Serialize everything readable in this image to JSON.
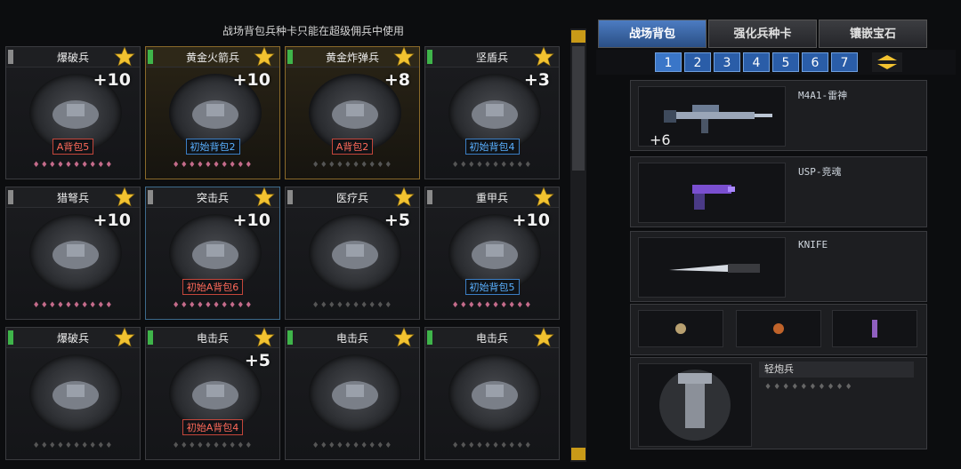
{
  "notice": "战场背包兵种卡只能在超级佣兵中使用",
  "cards": [
    {
      "name": "爆破兵",
      "level": "+10",
      "pack": "A背包5",
      "tag": "red",
      "flag": "gray",
      "style": "",
      "gems": "♦♦♦♦♦♦♦♦♦♦"
    },
    {
      "name": "黄金火箭兵",
      "level": "+10",
      "pack": "初始背包2",
      "tag": "blue",
      "flag": "green",
      "style": "gold",
      "gems": "♦♦♦♦♦♦♦♦♦♦"
    },
    {
      "name": "黄金炸弹兵",
      "level": "+8",
      "pack": "A背包2",
      "tag": "red",
      "flag": "green",
      "style": "gold",
      "gems": "♦♦♦♦♦♦♦♦♦♦"
    },
    {
      "name": "坚盾兵",
      "level": "+3",
      "pack": "初始背包4",
      "tag": "blue",
      "flag": "green",
      "style": "",
      "gems": "♦♦♦♦♦♦♦♦♦♦"
    },
    {
      "name": "猎弩兵",
      "level": "+10",
      "pack": "",
      "tag": "",
      "flag": "gray",
      "style": "",
      "gems": "♦♦♦♦♦♦♦♦♦♦"
    },
    {
      "name": "突击兵",
      "level": "+10",
      "pack": "初始A背包6",
      "tag": "red",
      "flag": "gray",
      "style": "blue",
      "gems": "♦♦♦♦♦♦♦♦♦♦"
    },
    {
      "name": "医疗兵",
      "level": "+5",
      "pack": "",
      "tag": "",
      "flag": "gray",
      "style": "",
      "gems": "♦♦♦♦♦♦♦♦♦♦"
    },
    {
      "name": "重甲兵",
      "level": "+10",
      "pack": "初始背包5",
      "tag": "blue",
      "flag": "gray",
      "style": "",
      "gems": "♦♦♦♦♦♦♦♦♦♦"
    },
    {
      "name": "爆破兵",
      "level": "",
      "pack": "",
      "tag": "",
      "flag": "green",
      "style": "",
      "gems": "♦♦♦♦♦♦♦♦♦♦"
    },
    {
      "name": "电击兵",
      "level": "+5",
      "pack": "初始A背包4",
      "tag": "red",
      "flag": "green",
      "style": "",
      "gems": "♦♦♦♦♦♦♦♦♦♦"
    },
    {
      "name": "电击兵",
      "level": "",
      "pack": "",
      "tag": "",
      "flag": "green",
      "style": "",
      "gems": "♦♦♦♦♦♦♦♦♦♦"
    },
    {
      "name": "电击兵",
      "level": "",
      "pack": "",
      "tag": "",
      "flag": "green",
      "style": "",
      "gems": "♦♦♦♦♦♦♦♦♦♦"
    }
  ],
  "tabs": [
    "战场背包",
    "强化兵种卡",
    "镶嵌宝石"
  ],
  "pages": [
    "1",
    "2",
    "3",
    "4",
    "5",
    "6",
    "7"
  ],
  "weapons": [
    {
      "name": "M4A1-雷神",
      "ammo": "+6"
    },
    {
      "name": "USP-竞魂",
      "ammo": ""
    },
    {
      "name": "KNIFE",
      "ammo": ""
    }
  ],
  "soldier_class": {
    "name": "轻炮兵",
    "gems": "♦♦♦♦♦♦♦♦♦♦"
  },
  "colors": {
    "accent": "#3a76c8",
    "gold": "#f2c230",
    "redTag": "#ff6a5a",
    "blueTag": "#5ab0ff"
  }
}
